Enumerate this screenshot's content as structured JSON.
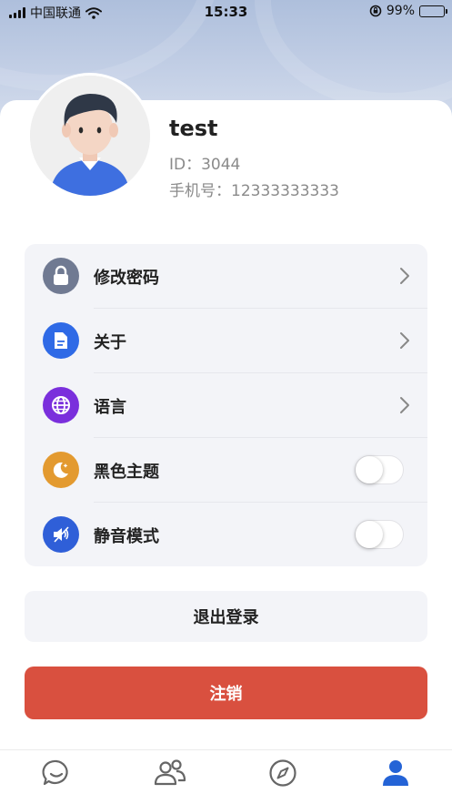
{
  "status_bar": {
    "carrier": "中国联通",
    "time": "15:33",
    "battery": "99%",
    "battery_level": 0.99,
    "icons": [
      "signal-icon",
      "wifi-icon",
      "orientation-lock-icon",
      "battery-icon"
    ]
  },
  "profile": {
    "name": "test",
    "id_text": "ID：3044",
    "phone_text": "手机号：12333333333"
  },
  "settings": {
    "items": [
      {
        "label": "修改密码",
        "icon": "lock-icon",
        "color": "#707a92",
        "control": "chevron"
      },
      {
        "label": "关于",
        "icon": "document-icon",
        "color": "#2f6ae6",
        "control": "chevron"
      },
      {
        "label": "语言",
        "icon": "globe-icon",
        "color": "#7a2fdc",
        "control": "chevron"
      },
      {
        "label": "黑色主题",
        "icon": "moon-icon",
        "color": "#e39a30",
        "control": "toggle",
        "on": false
      },
      {
        "label": "静音模式",
        "icon": "mute-icon",
        "color": "#2f5fd8",
        "control": "toggle",
        "on": false
      }
    ]
  },
  "buttons": {
    "logout": "退出登录",
    "delete_account": "注销"
  },
  "tabbar": {
    "tabs": [
      {
        "icon": "chat-icon",
        "active": false
      },
      {
        "icon": "contacts-icon",
        "active": false
      },
      {
        "icon": "compass-icon",
        "active": false
      },
      {
        "icon": "profile-icon",
        "active": true
      }
    ]
  },
  "colors": {
    "accent": "#2f6ae6",
    "danger": "#d9503f",
    "panel_bg": "#f3f4f8"
  }
}
